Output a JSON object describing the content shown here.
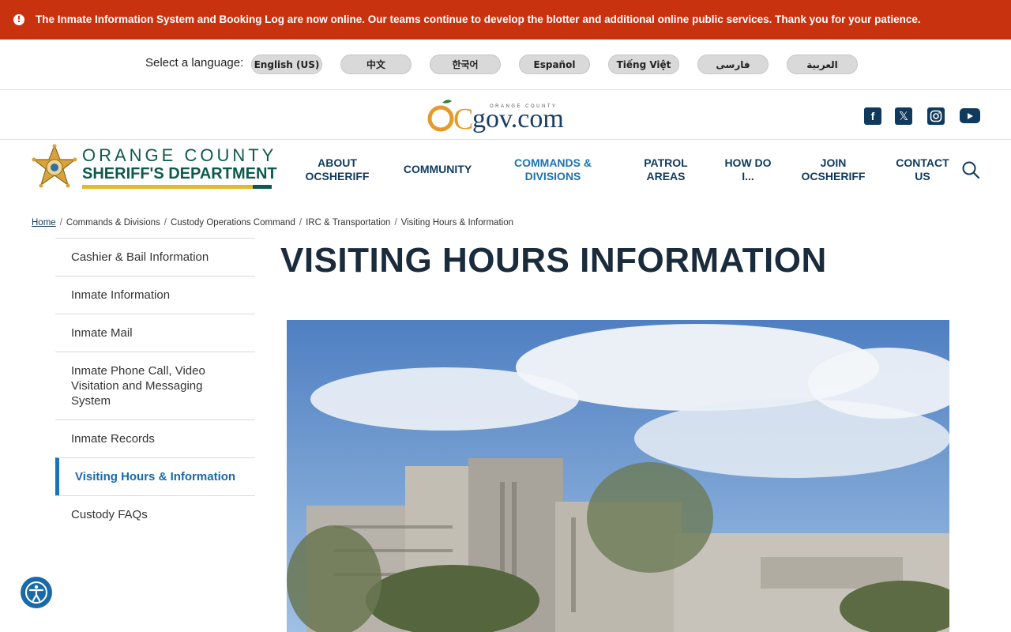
{
  "alert": {
    "text": "The Inmate Information System and Booking Log are now online. Our teams continue to develop the blotter and additional online public services. Thank you for your patience."
  },
  "language": {
    "label": "Select a language:",
    "options": [
      "English (US)",
      "中文",
      "한국어",
      "Español",
      "Tiếng Việt",
      "فارسی",
      "العربية"
    ]
  },
  "ocgov": {
    "logo_text": "gov.com",
    "logo_letters": "OC",
    "logo_small": "ORANGE COUNTY"
  },
  "social": {
    "icons": [
      "facebook-icon",
      "x-icon",
      "instagram-icon",
      "youtube-icon"
    ]
  },
  "brand": {
    "line1": "ORANGE COUNTY",
    "line2": "SHERIFF'S DEPARTMENT"
  },
  "nav": {
    "items": [
      {
        "line1": "ABOUT",
        "line2": "OCSHERIFF"
      },
      {
        "line1": "COMMUNITY",
        "line2": ""
      },
      {
        "line1": "COMMANDS &",
        "line2": "DIVISIONS"
      },
      {
        "line1": "PATROL",
        "line2": "AREAS"
      },
      {
        "line1": "HOW DO",
        "line2": "I..."
      },
      {
        "line1": "JOIN",
        "line2": "OCSHERIFF"
      },
      {
        "line1": "CONTACT",
        "line2": "US"
      }
    ]
  },
  "breadcrumb": {
    "items": [
      "Home",
      "Commands & Divisions",
      "Custody Operations Command",
      "IRC & Transportation",
      "Visiting Hours & Information"
    ]
  },
  "sidebar": {
    "items": [
      {
        "label": "Cashier & Bail Information"
      },
      {
        "label": "Inmate Information"
      },
      {
        "label": "Inmate Mail"
      },
      {
        "label": "Inmate Phone Call, Video Visitation and Messaging System"
      },
      {
        "label": "Inmate Records"
      },
      {
        "label": "Visiting Hours & Information"
      },
      {
        "label": "Custody FAQs"
      }
    ]
  },
  "main": {
    "title": "VISITING HOURS INFORMATION"
  },
  "colors": {
    "alert": "#c8320f",
    "navy": "#0f3a5e",
    "accent": "#1a73b5",
    "brand_green": "#0e5a4c",
    "brand_gold": "#e5b92d"
  }
}
